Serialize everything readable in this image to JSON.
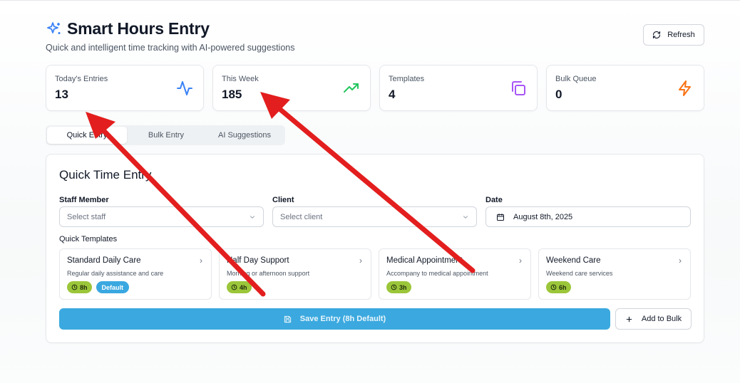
{
  "header": {
    "title": "Smart Hours Entry",
    "subtitle": "Quick and intelligent time tracking with AI-powered suggestions",
    "refresh_label": "Refresh"
  },
  "stats": [
    {
      "label": "Today's Entries",
      "value": "13",
      "icon": "activity-icon",
      "color": "#3b82f6"
    },
    {
      "label": "This Week",
      "value": "185",
      "icon": "trending-up-icon",
      "color": "#22c55e"
    },
    {
      "label": "Templates",
      "value": "4",
      "icon": "copy-icon",
      "color": "#a855f7"
    },
    {
      "label": "Bulk Queue",
      "value": "0",
      "icon": "zap-icon",
      "color": "#f97316"
    }
  ],
  "tabs": [
    {
      "label": "Quick Entry",
      "active": true
    },
    {
      "label": "Bulk Entry",
      "active": false
    },
    {
      "label": "AI Suggestions",
      "active": false
    }
  ],
  "form": {
    "title": "Quick Time Entry",
    "staff_label": "Staff Member",
    "staff_placeholder": "Select staff",
    "client_label": "Client",
    "client_placeholder": "Select client",
    "date_label": "Date",
    "date_value": "August 8th, 2025",
    "templates_label": "Quick Templates"
  },
  "templates": [
    {
      "name": "Standard Daily Care",
      "description": "Regular daily assistance and care",
      "hours": "8h",
      "badge": "Default"
    },
    {
      "name": "Half Day Support",
      "description": "Morning or afternoon support",
      "hours": "4h"
    },
    {
      "name": "Medical Appointment",
      "description": "Accompany to medical appointment",
      "hours": "3h"
    },
    {
      "name": "Weekend Care",
      "description": "Weekend care services",
      "hours": "6h"
    }
  ],
  "actions": {
    "save_label": "Save Entry (8h Default)",
    "add_bulk_label": "Add to Bulk"
  },
  "colors": {
    "accent": "#3ba9df",
    "hours_badge": "#9bc63a",
    "annotation_arrow": "#e31e1e"
  }
}
